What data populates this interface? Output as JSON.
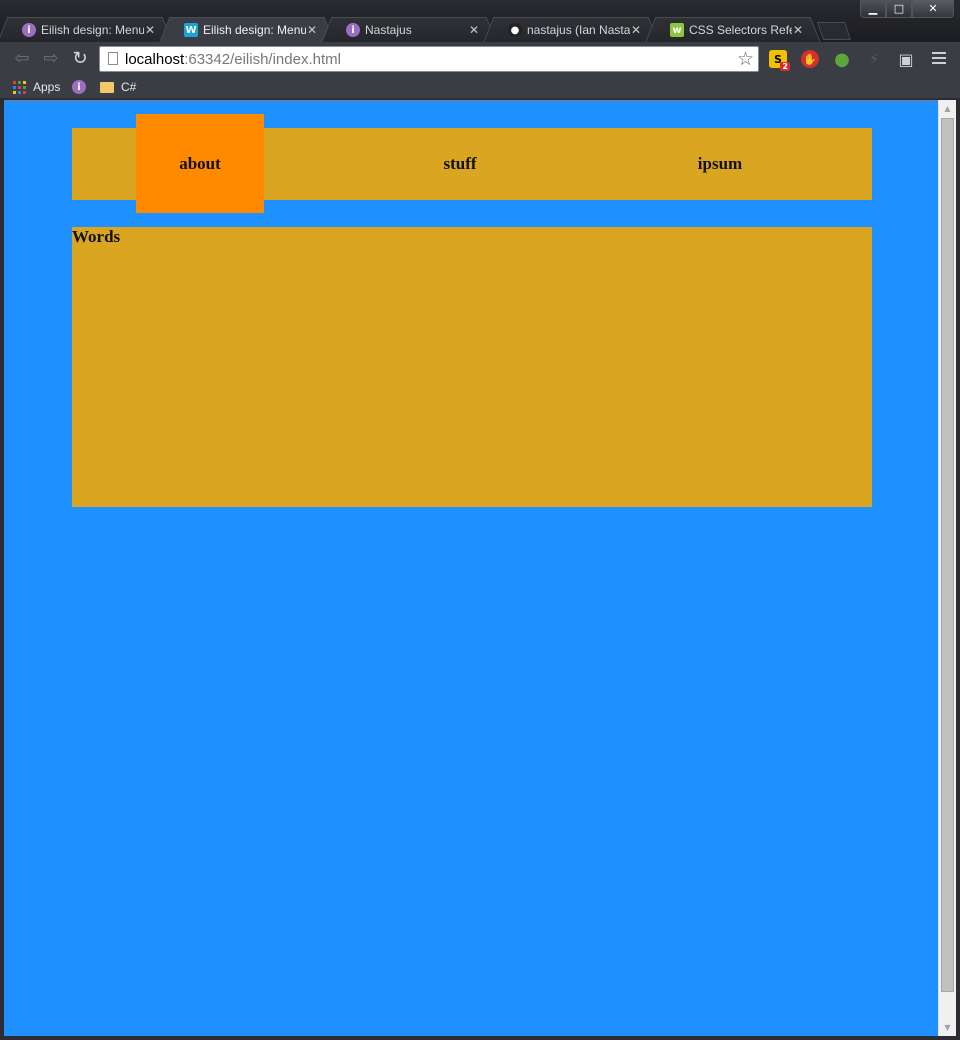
{
  "browser": {
    "tabs": [
      {
        "title": "Eilish design: Menus",
        "icon": "info-icon",
        "icon_color": "#9b6fc0",
        "active": false
      },
      {
        "title": "Eilish design: Menus",
        "icon": "webstorm-icon",
        "icon_color": "#1aa3d9",
        "active": true
      },
      {
        "title": "Nastajus",
        "icon": "info-icon",
        "icon_color": "#9b6fc0",
        "active": false
      },
      {
        "title": "nastajus (Ian Nastajus)",
        "icon": "github-icon",
        "icon_color": "#222222",
        "active": false
      },
      {
        "title": "CSS Selectors Reference",
        "icon": "w3schools-icon",
        "icon_color": "#8dc63f",
        "active": false
      }
    ],
    "window_controls": {
      "minimize": "▁",
      "maximize": "□",
      "close": "✕"
    },
    "tab_close_glyph": "✕",
    "url_host": "localhost",
    "url_rest": ":63342/eilish/index.html",
    "bookmarks": [
      {
        "label": "Apps",
        "icon": "apps-grid-icon"
      },
      {
        "label": "",
        "icon": "info-icon"
      },
      {
        "label": "C#",
        "icon": "folder-icon"
      }
    ],
    "extensions": [
      {
        "name": "s2-extension-icon",
        "glyph": "S",
        "badge": "2",
        "color": "#f2c200"
      },
      {
        "name": "adblock-icon",
        "glyph": "✋",
        "color": "#d32f2f"
      },
      {
        "name": "evernote-icon",
        "glyph": "●",
        "color": "#5ba53a"
      },
      {
        "name": "lightning-icon",
        "glyph": "⚡",
        "color": "#555a63"
      },
      {
        "name": "screenshot-icon",
        "glyph": "▣",
        "color": "#cfd0d3"
      }
    ]
  },
  "page": {
    "background_color": "#1e90ff",
    "nav_background_color": "#daa520",
    "nav_active_color": "#ff8a00",
    "nav": [
      {
        "label": "about",
        "active": true
      },
      {
        "label": "stuff",
        "active": false
      },
      {
        "label": "ipsum",
        "active": false
      }
    ],
    "content_heading": "Words"
  }
}
